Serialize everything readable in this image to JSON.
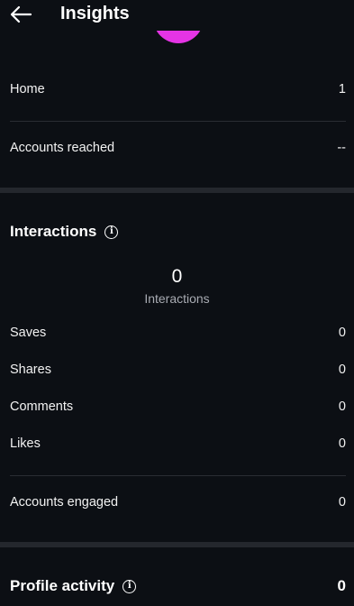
{
  "header": {
    "title": "Insights"
  },
  "reach": {
    "home": {
      "label": "Home",
      "value": "1"
    },
    "accounts_reached": {
      "label": "Accounts reached",
      "value": "--"
    }
  },
  "interactions": {
    "title": "Interactions",
    "total": "0",
    "total_label": "Interactions",
    "items": [
      {
        "label": "Saves",
        "value": "0"
      },
      {
        "label": "Shares",
        "value": "0"
      },
      {
        "label": "Comments",
        "value": "0"
      },
      {
        "label": "Likes",
        "value": "0"
      }
    ],
    "accounts_engaged": {
      "label": "Accounts engaged",
      "value": "0"
    }
  },
  "profile_activity": {
    "title": "Profile activity",
    "value": "0"
  },
  "colors": {
    "background": "#0c0f14",
    "accent": "#e534e5",
    "divider": "#24272d"
  }
}
